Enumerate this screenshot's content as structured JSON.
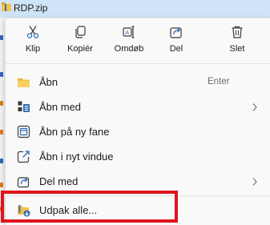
{
  "file": {
    "name": "RDP.zip",
    "icon": "zip-folder-icon"
  },
  "toolbar": {
    "buttons": [
      {
        "label": "Klip",
        "icon": "cut-icon"
      },
      {
        "label": "Kopiér",
        "icon": "copy-icon"
      },
      {
        "label": "Omdøb",
        "icon": "rename-icon"
      },
      {
        "label": "Del",
        "icon": "share-icon"
      },
      {
        "label": "Slet",
        "icon": "trash-icon"
      }
    ]
  },
  "menu": {
    "items": [
      {
        "label": "Åbn",
        "shortcut": "Enter",
        "icon": "folder-icon"
      },
      {
        "label": "Åbn med",
        "submenu": true,
        "icon": "open-with-icon"
      },
      {
        "label": "Åbn på ny fane",
        "icon": "new-tab-icon"
      },
      {
        "label": "Åbn i nyt vindue",
        "icon": "new-window-icon"
      },
      {
        "label": "Del med",
        "submenu": true,
        "icon": "share-icon"
      },
      {
        "label": "Udpak alle...",
        "icon": "extract-icon"
      }
    ]
  },
  "colors": {
    "accent": "#0067c0",
    "highlight_box": "#e0141e",
    "folder": "#f5c24a"
  }
}
